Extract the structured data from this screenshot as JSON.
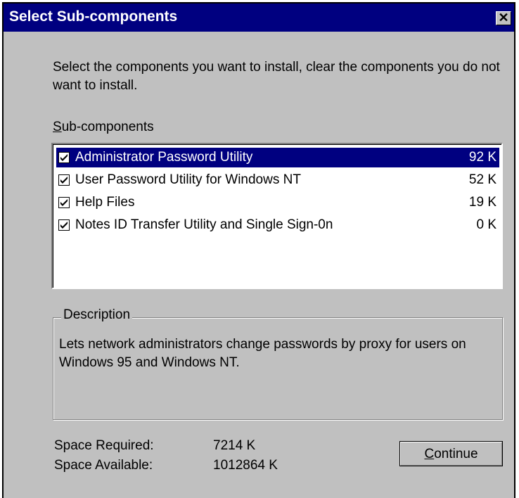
{
  "window": {
    "title": "Select Sub-components",
    "close_glyph": "✕"
  },
  "instructions": "Select the components you want to install, clear the components you do not want to install.",
  "subcomponents_label": "Sub-components",
  "items": [
    {
      "label": "Administrator Password Utility",
      "size": "92 K",
      "checked": true,
      "selected": true
    },
    {
      "label": "User Password Utility for Windows NT",
      "size": "52 K",
      "checked": true,
      "selected": false
    },
    {
      "label": "Help Files",
      "size": "19 K",
      "checked": true,
      "selected": false
    },
    {
      "label": "Notes ID Transfer Utility and Single Sign-0n",
      "size": "0 K",
      "checked": true,
      "selected": false
    }
  ],
  "description": {
    "legend": "Description",
    "text": "Lets network administrators change passwords by proxy for users on Windows 95 and Windows NT."
  },
  "space": {
    "required_label": "Space Required:",
    "required_value": "7214 K",
    "available_label": "Space Available:",
    "available_value": "1012864 K"
  },
  "continue_label": "Continue",
  "colors": {
    "titlebar": "#000080",
    "face": "#c0c0c0",
    "selection": "#000080"
  },
  "icons": {
    "close": "close-icon",
    "checkbox": "checkmark-icon"
  }
}
